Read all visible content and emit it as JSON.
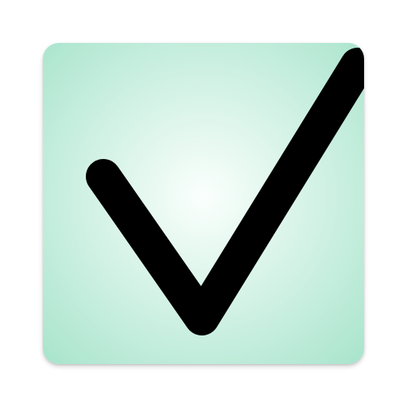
{
  "icon": {
    "name": "checkmark-icon",
    "gradient_center_color": "#fbfffd",
    "gradient_edge_color": "#a8e4cc",
    "check_color": "#000000"
  }
}
